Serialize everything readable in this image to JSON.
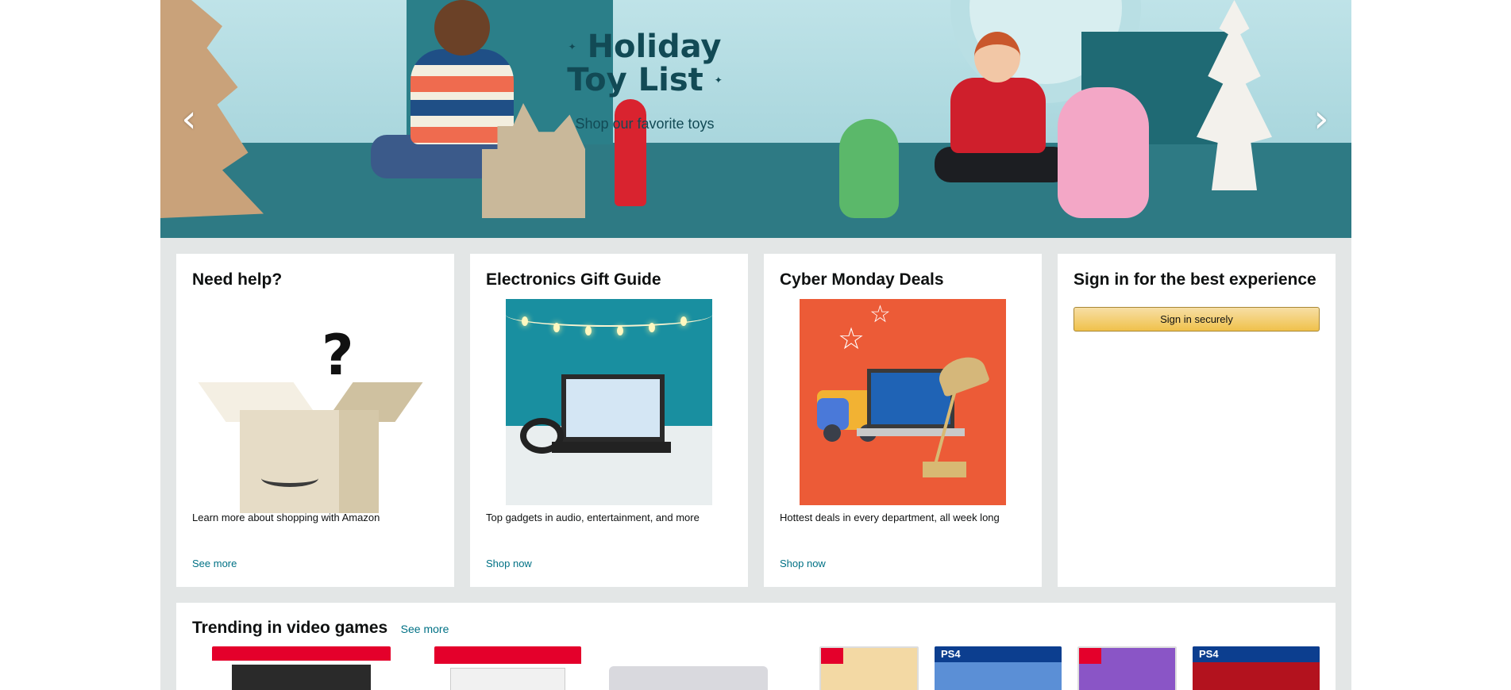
{
  "hero": {
    "title": "Holiday Toy List",
    "subtitle": "Shop our favorite toys",
    "prev_arrow": "‹",
    "next_arrow": "›"
  },
  "cards": [
    {
      "title": "Need help?",
      "description": "Learn more about shopping with Amazon",
      "link": "See more"
    },
    {
      "title": "Electronics Gift Guide",
      "description": "Top gadgets in audio, entertainment, and more",
      "link": "Shop now"
    },
    {
      "title": "Cyber Monday Deals",
      "description": "Hottest deals in every department, all week long",
      "link": "Shop now"
    },
    {
      "title": "Sign in for the best experience",
      "button": "Sign in securely"
    }
  ],
  "trending": {
    "title": "Trending in video games",
    "link": "See more",
    "ps4_label": "PS4"
  },
  "colors": {
    "link": "#007185",
    "button": "#f0c14b",
    "background": "#e3e6e6",
    "hero_teal": "#124a55"
  }
}
